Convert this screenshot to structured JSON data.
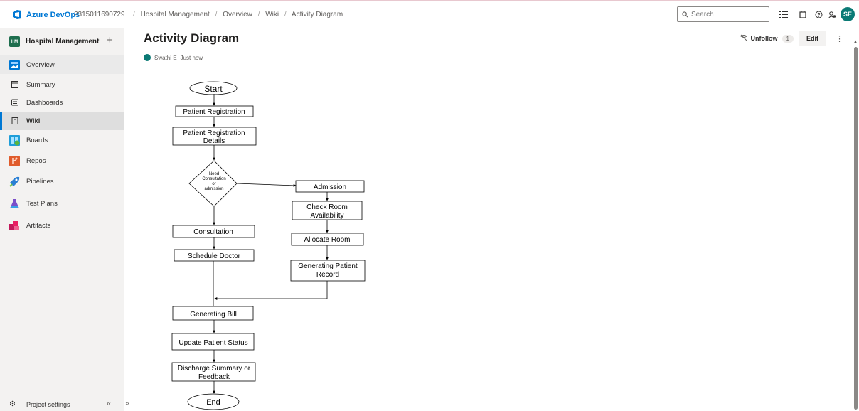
{
  "header": {
    "brand": "Azure DevOps",
    "org": "2315011690729",
    "breadcrumbs": [
      "Hospital Management",
      "Overview",
      "Wiki",
      "Activity Diagram"
    ],
    "search_placeholder": "Search",
    "avatar_initials": "SE"
  },
  "sidebar": {
    "project_badge": "HM",
    "project_name": "Hospital Management",
    "add_label": "+",
    "items": [
      {
        "label": "Overview",
        "icon": "overview-icon"
      },
      {
        "label": "Summary",
        "icon": "summary-icon"
      },
      {
        "label": "Dashboards",
        "icon": "dashboards-icon"
      },
      {
        "label": "Wiki",
        "icon": "wiki-icon"
      },
      {
        "label": "Boards",
        "icon": "boards-icon"
      },
      {
        "label": "Repos",
        "icon": "repos-icon"
      },
      {
        "label": "Pipelines",
        "icon": "pipelines-icon"
      },
      {
        "label": "Test Plans",
        "icon": "test-plans-icon"
      },
      {
        "label": "Artifacts",
        "icon": "artifacts-icon"
      }
    ],
    "settings_label": "Project settings",
    "collapse_label": "«",
    "expand_label": "»"
  },
  "page": {
    "title": "Activity Diagram",
    "author": "Swathi E",
    "timestamp": "Just now",
    "unfollow_label": "Unfollow",
    "follower_count": "1",
    "edit_label": "Edit",
    "more_label": "⋮"
  },
  "diagram": {
    "start": "Start",
    "end": "End",
    "patient_registration": "Patient Registration",
    "registration_details": [
      "Patient Registration",
      "Details"
    ],
    "decision": [
      "Need",
      "Consultation",
      "or",
      "admission"
    ],
    "admission": "Admission",
    "check_room": [
      "Check  Room",
      "Availability"
    ],
    "allocate_room": "Allocate Room",
    "generating_record": [
      "Generating Patient",
      "Record"
    ],
    "consultation": "Consultation",
    "schedule_doctor": "Schedule Doctor",
    "generating_bill": "Generating Bill",
    "update_status": "Update Patient Status",
    "discharge": [
      "Discharge Summary or",
      "Feedback"
    ]
  },
  "colors": {
    "accent": "#0078d4",
    "project_badge": "#1e6e4e",
    "avatar": "#0b7a75"
  }
}
